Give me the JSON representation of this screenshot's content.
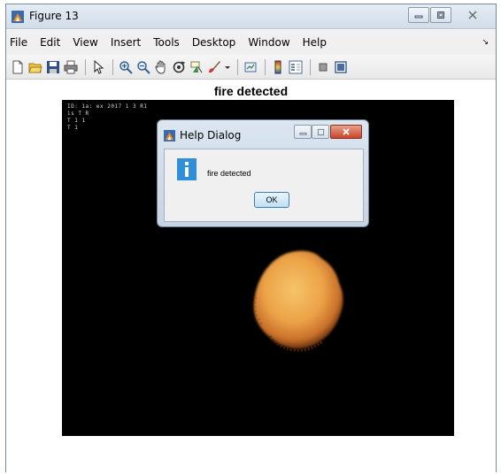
{
  "window": {
    "title": "Figure 13"
  },
  "menu": {
    "items": [
      "File",
      "Edit",
      "View",
      "Insert",
      "Tools",
      "Desktop",
      "Window",
      "Help"
    ]
  },
  "toolbar": {
    "icons": [
      "new-figure-icon",
      "open-file-icon",
      "save-icon",
      "print-icon",
      "pointer-icon",
      "zoom-in-icon",
      "zoom-out-icon",
      "pan-icon",
      "rotate-3d-icon",
      "data-cursor-icon",
      "brush-icon",
      "brush-dropdown-icon",
      "link-plot-icon",
      "colorbar-icon",
      "legend-icon",
      "hide-plot-tools-icon",
      "show-plot-tools-icon"
    ]
  },
  "figure": {
    "plot_title": "fire detected",
    "image_overlay_lines": [
      "ID: 1a: ex 2017 1 3 R1",
      "  is  T  R  ",
      "T 1 1",
      "T 1    "
    ]
  },
  "dialog": {
    "title": "Help Dialog",
    "message": "fire detected",
    "ok_label": "OK",
    "accent": "#2f8fd8"
  },
  "colors": {
    "fire_core": "#f2b45a",
    "fire_edge": "#b85a14",
    "axes_bg": "#000000"
  }
}
